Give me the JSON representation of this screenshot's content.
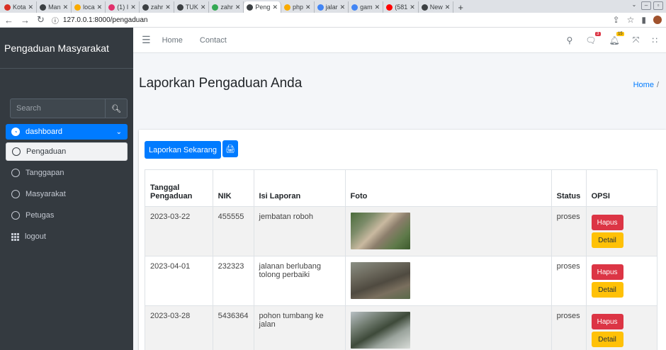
{
  "browser": {
    "tabs": [
      {
        "label": "Kota",
        "color": "#d93025"
      },
      {
        "label": "Man",
        "color": "#3c4043"
      },
      {
        "label": "loca",
        "color": "#f9ab00"
      },
      {
        "label": "(1) I",
        "color": "#e1306c"
      },
      {
        "label": "zahr",
        "color": "#3c4043"
      },
      {
        "label": "TUK",
        "color": "#3c4043"
      },
      {
        "label": "zahr",
        "color": "#34a853"
      },
      {
        "label": "Peng",
        "color": "#3c4043",
        "active": true
      },
      {
        "label": "php",
        "color": "#f9ab00"
      },
      {
        "label": "jalar",
        "color": "#4285f4"
      },
      {
        "label": "gam",
        "color": "#4285f4"
      },
      {
        "label": "(581",
        "color": "#ff0000"
      },
      {
        "label": "New",
        "color": "#3c4043"
      }
    ],
    "url": "127.0.0.1:8000/pengaduan"
  },
  "sidebar": {
    "brand": "Pengaduan Masyarakat",
    "search_placeholder": "Search",
    "items": [
      {
        "label": "dashboard"
      },
      {
        "label": "Pengaduan"
      },
      {
        "label": "Tanggapan"
      },
      {
        "label": "Masyarakat"
      },
      {
        "label": "Petugas"
      },
      {
        "label": "logout"
      }
    ]
  },
  "topnav": {
    "home": "Home",
    "contact": "Contact",
    "messages_badge": "3",
    "notifications_badge": "15"
  },
  "content": {
    "title": "Laporkan Pengaduan Anda",
    "breadcrumb": "Home",
    "breadcrumb_sep": "/"
  },
  "card": {
    "report_button": "Laporkan Sekarang",
    "table": {
      "headers": [
        "Tanggal Pengaduan",
        "NIK",
        "Isi Laporan",
        "Foto",
        "Status",
        "OPSI"
      ],
      "rows": [
        {
          "tanggal": "2023-03-22",
          "nik": "455555",
          "isi": "jembatan roboh",
          "status": "proses"
        },
        {
          "tanggal": "2023-04-01",
          "nik": "232323",
          "isi": "jalanan berlubang tolong perbaiki",
          "status": "proses"
        },
        {
          "tanggal": "2023-03-28",
          "nik": "5436364",
          "isi": "pohon tumbang ke jalan",
          "status": "proses"
        }
      ],
      "delete_label": "Hapus",
      "detail_label": "Detail"
    }
  }
}
